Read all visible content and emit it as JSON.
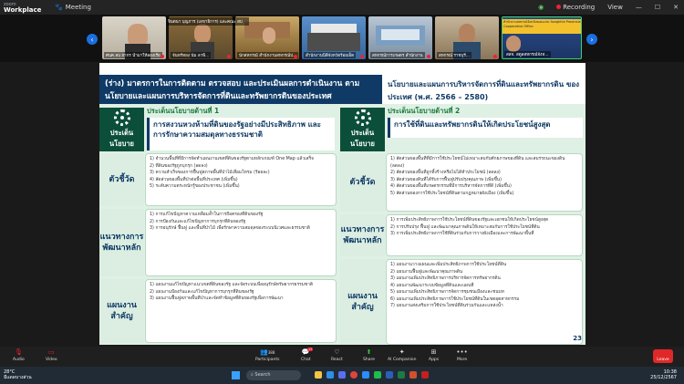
{
  "topbar": {
    "logo_line1": "zoom",
    "logo_line2": "Workplace",
    "meeting_label": "Meeting",
    "recording": "Recording",
    "view": "View"
  },
  "gallery": {
    "tiles": [
      {
        "label": "ศนค.ลบ ยากร นำมาให้ลองเรีย"
      },
      {
        "label": "จันทร์ทอง นัม ลาพิ..."
      },
      {
        "label": "นักสหกรณ์ สำนักงานสหกรณ์ป..."
      },
      {
        "label": "สำนักงานนิติจังหวัดร้อยเอ็ด"
      },
      {
        "label": "สหกรณ์การเกษตร สำนักงาน"
      },
      {
        "label": "สหกรณ์ ราชบุรี..."
      },
      {
        "label": "สสจ. สตูลสหกรณ์จังห..."
      }
    ],
    "speaker_name": "จินตนา บุญภาร (เลขาธิการ) และคณะ สป",
    "speaker_sign": "สำนักงานสหกรณ์จังหวัดขอนแก่น Songkhla Provincial Cooperative Office"
  },
  "slide": {
    "header_left": "(ร่าง) มาตรการในการติดตาม ตรวจสอบ และประเมินผลการดำเนินงาน ตามนโยบายและแผนการบริหารจัดการที่ดินและทรัพยากรดินของประเทศ",
    "header_right": "นโยบายและแผนการบริหารจัดการที่ดินและทรัพยากรดิน ของประเทศ (พ.ศ. 2566 – 2580)",
    "left": {
      "side_policy": "ประเด็นนโยบาย",
      "issue_title": "ประเด็นนโยบายด้านที่ 1",
      "issue_body": "การสงวนหวงห้ามที่ดินของรัฐอย่างมีประสิทธิภาพ และการรักษาความสมดุลทางธรรมชาติ",
      "side_indicator": "ตัวชี้วัด",
      "indicators": [
        "1) จำนวนพื้นที่ที่มีการจัดทำแผนงานเขตที่ดินของรัฐตามหลักเกณฑ์ One Map แล้วเสร็จ",
        "2) ที่ดินของรัฐถูกบุกรุก (ลดลง)",
        "3) ความสำเร็จของการฟื้นฟูสภาพพื้นที่ป่าไม้เสื่อมโทรม (ร้อยละ)",
        "4) สัดส่วนของพื้นที่ป่าต่อพื้นที่ประเทศ (เพิ่มขึ้น)",
        "5) ระดับความตระหนักรู้ของประชาชน (เพิ่มขึ้น)"
      ],
      "side_approach": "แนวทางการพัฒนาหลัก",
      "approaches": [
        "1) การแก้ไขปัญหาความเหลื่อมล้ำในการถือครองที่ดินของรัฐ",
        "2) การป้องกันและแก้ไขปัญหาการบุกรุกที่ดินของรัฐ",
        "3) การอนุรักษ์ ฟื้นฟู และพื้นที่ป่าไม้ เพื่อรักษาความสมดุลของระบบนิเวศและธรรมชาติ"
      ],
      "side_plan": "แผนงานสำคัญ",
      "plans": [
        "1) แผนงานแก้ไขปัญหาแนวเขตที่ดินของรัฐ และจัดระบบเพื่ออนุรักษ์ทรัพยากรธรรมชาติ",
        "2) แผนงานป้องกันและแก้ไขปัญหาการบุกรุกที่ดินของรัฐ",
        "3) แผนงานฟื้นฟูสภาพพื้นที่ป่าและจัดทำข้อมูลที่ดินของรัฐเพื่อการพัฒนา"
      ]
    },
    "right": {
      "side_policy": "ประเด็นนโยบาย",
      "issue_title": "ประเด็นนโยบายด้านที่ 2",
      "issue_body": "การใช้ที่ดินและทรัพยากรดินให้เกิดประโยชน์สูงสุด",
      "side_indicator": "ตัวชี้วัด",
      "indicators": [
        "1) สัดส่วนของพื้นที่ที่มีการใช้ประโยชน์ไม่เหมาะสมกับศักยภาพของที่ดิน และสมรรถนะของดิน (ลดลง)",
        "2) สัดส่วนของพื้นที่ถูกทิ้งร้างหรือไม่ได้ทำประโยชน์ (ลดลง)",
        "3) สัดส่วนของดินที่ได้รับการฟื้นฟูปรับปรุงคุณภาพ (เพิ่มขึ้น)",
        "4) สัดส่วนของพื้นที่เกษตรกรรมที่มีการบริหารจัดการที่ดี (เพิ่มขึ้น)",
        "5) สัดส่วนของการใช้ประโยชน์ที่ดินตามกฎหมายผังเมือง (เพิ่มขึ้น)"
      ],
      "side_approach": "แนวทางการพัฒนาหลัก",
      "approaches": [
        "1) การเพิ่มประสิทธิภาพการใช้ประโยชน์ที่ดินของรัฐและเอกชนให้เกิดประโยชน์สูงสุด",
        "2) การปรับปรุง ฟื้นฟู และพัฒนาคุณภาพดินให้เหมาะสมกับการใช้ประโยชน์ที่ดิน",
        "3) การเพิ่มประสิทธิภาพการใช้ที่ดินร่วมกับการวางผังเมืองและการพัฒนาพื้นที่"
      ],
      "side_plan": "แผนงานสำคัญ",
      "plans": [
        "1) แผนงานวางแผนและเพิ่มประสิทธิภาพการใช้ประโยชน์ที่ดิน",
        "2) แผนงานฟื้นฟูและพัฒนาคุณภาพดิน",
        "3) แผนงานเพิ่มประสิทธิภาพการบริหารจัดการทรัพยากรดิน",
        "4) แผนงานพัฒนาระบบข้อมูลที่ดินและแผนที่",
        "5) แผนงานเพิ่มประสิทธิภาพการจัดการชุมชนเมืองและชนบท",
        "6) แผนงานเพิ่มประสิทธิภาพการใช้ประโยชน์ที่ดินในเขตอุตสาหกรรม",
        "7) แผนงานส่งเสริมการใช้ประโยชน์ที่ดินร่วมกันและแหล่งน้ำ"
      ],
      "page": "23"
    }
  },
  "bottombar": {
    "items": [
      {
        "label": "Audio",
        "icon": "microphone-icon"
      },
      {
        "label": "Video",
        "icon": "video-icon"
      },
      {
        "label": "Participants",
        "count": "388",
        "icon": "participants-icon"
      },
      {
        "label": "Chat",
        "badge": "13",
        "icon": "chat-icon"
      },
      {
        "label": "React",
        "icon": "heart-icon"
      },
      {
        "label": "Share",
        "icon": "share-icon"
      },
      {
        "label": "AI Companion",
        "icon": "ai-icon"
      },
      {
        "label": "Apps",
        "icon": "apps-icon"
      },
      {
        "label": "More",
        "icon": "more-icon"
      }
    ],
    "leave": "Leave"
  },
  "taskbar": {
    "weather_temp": "28°C",
    "weather_desc": "มีแดดบางส่วน",
    "search_placeholder": "Search",
    "time": "10:38",
    "date": "25/12/2567"
  },
  "colors": {
    "slide_navy": "#0f3a66",
    "slide_green": "#0b4f3a",
    "accent_blue": "#1b6fe0",
    "leave_red": "#e02828"
  }
}
